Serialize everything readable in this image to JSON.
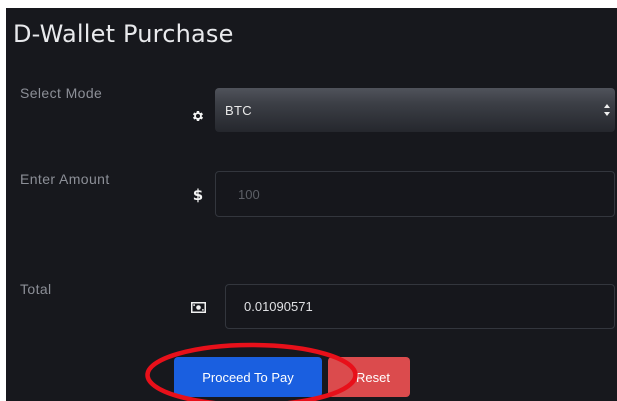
{
  "page": {
    "title": "D-Wallet Purchase"
  },
  "form": {
    "mode_label": "Select Mode",
    "mode_icon": "gear-icon",
    "mode_value": "BTC",
    "amount_label": "Enter Amount",
    "amount_icon": "dollar-icon",
    "amount_symbol": "$",
    "amount_placeholder": "100",
    "total_label": "Total",
    "total_icon": "money-icon",
    "total_value": "0.01090571"
  },
  "actions": {
    "proceed_label": "Proceed To Pay",
    "reset_label": "Reset"
  },
  "colors": {
    "panel_background": "#17181d",
    "proceed_button": "#1a5fe0",
    "reset_button": "#db4b4d",
    "highlight_annotation": "#e8101a"
  }
}
